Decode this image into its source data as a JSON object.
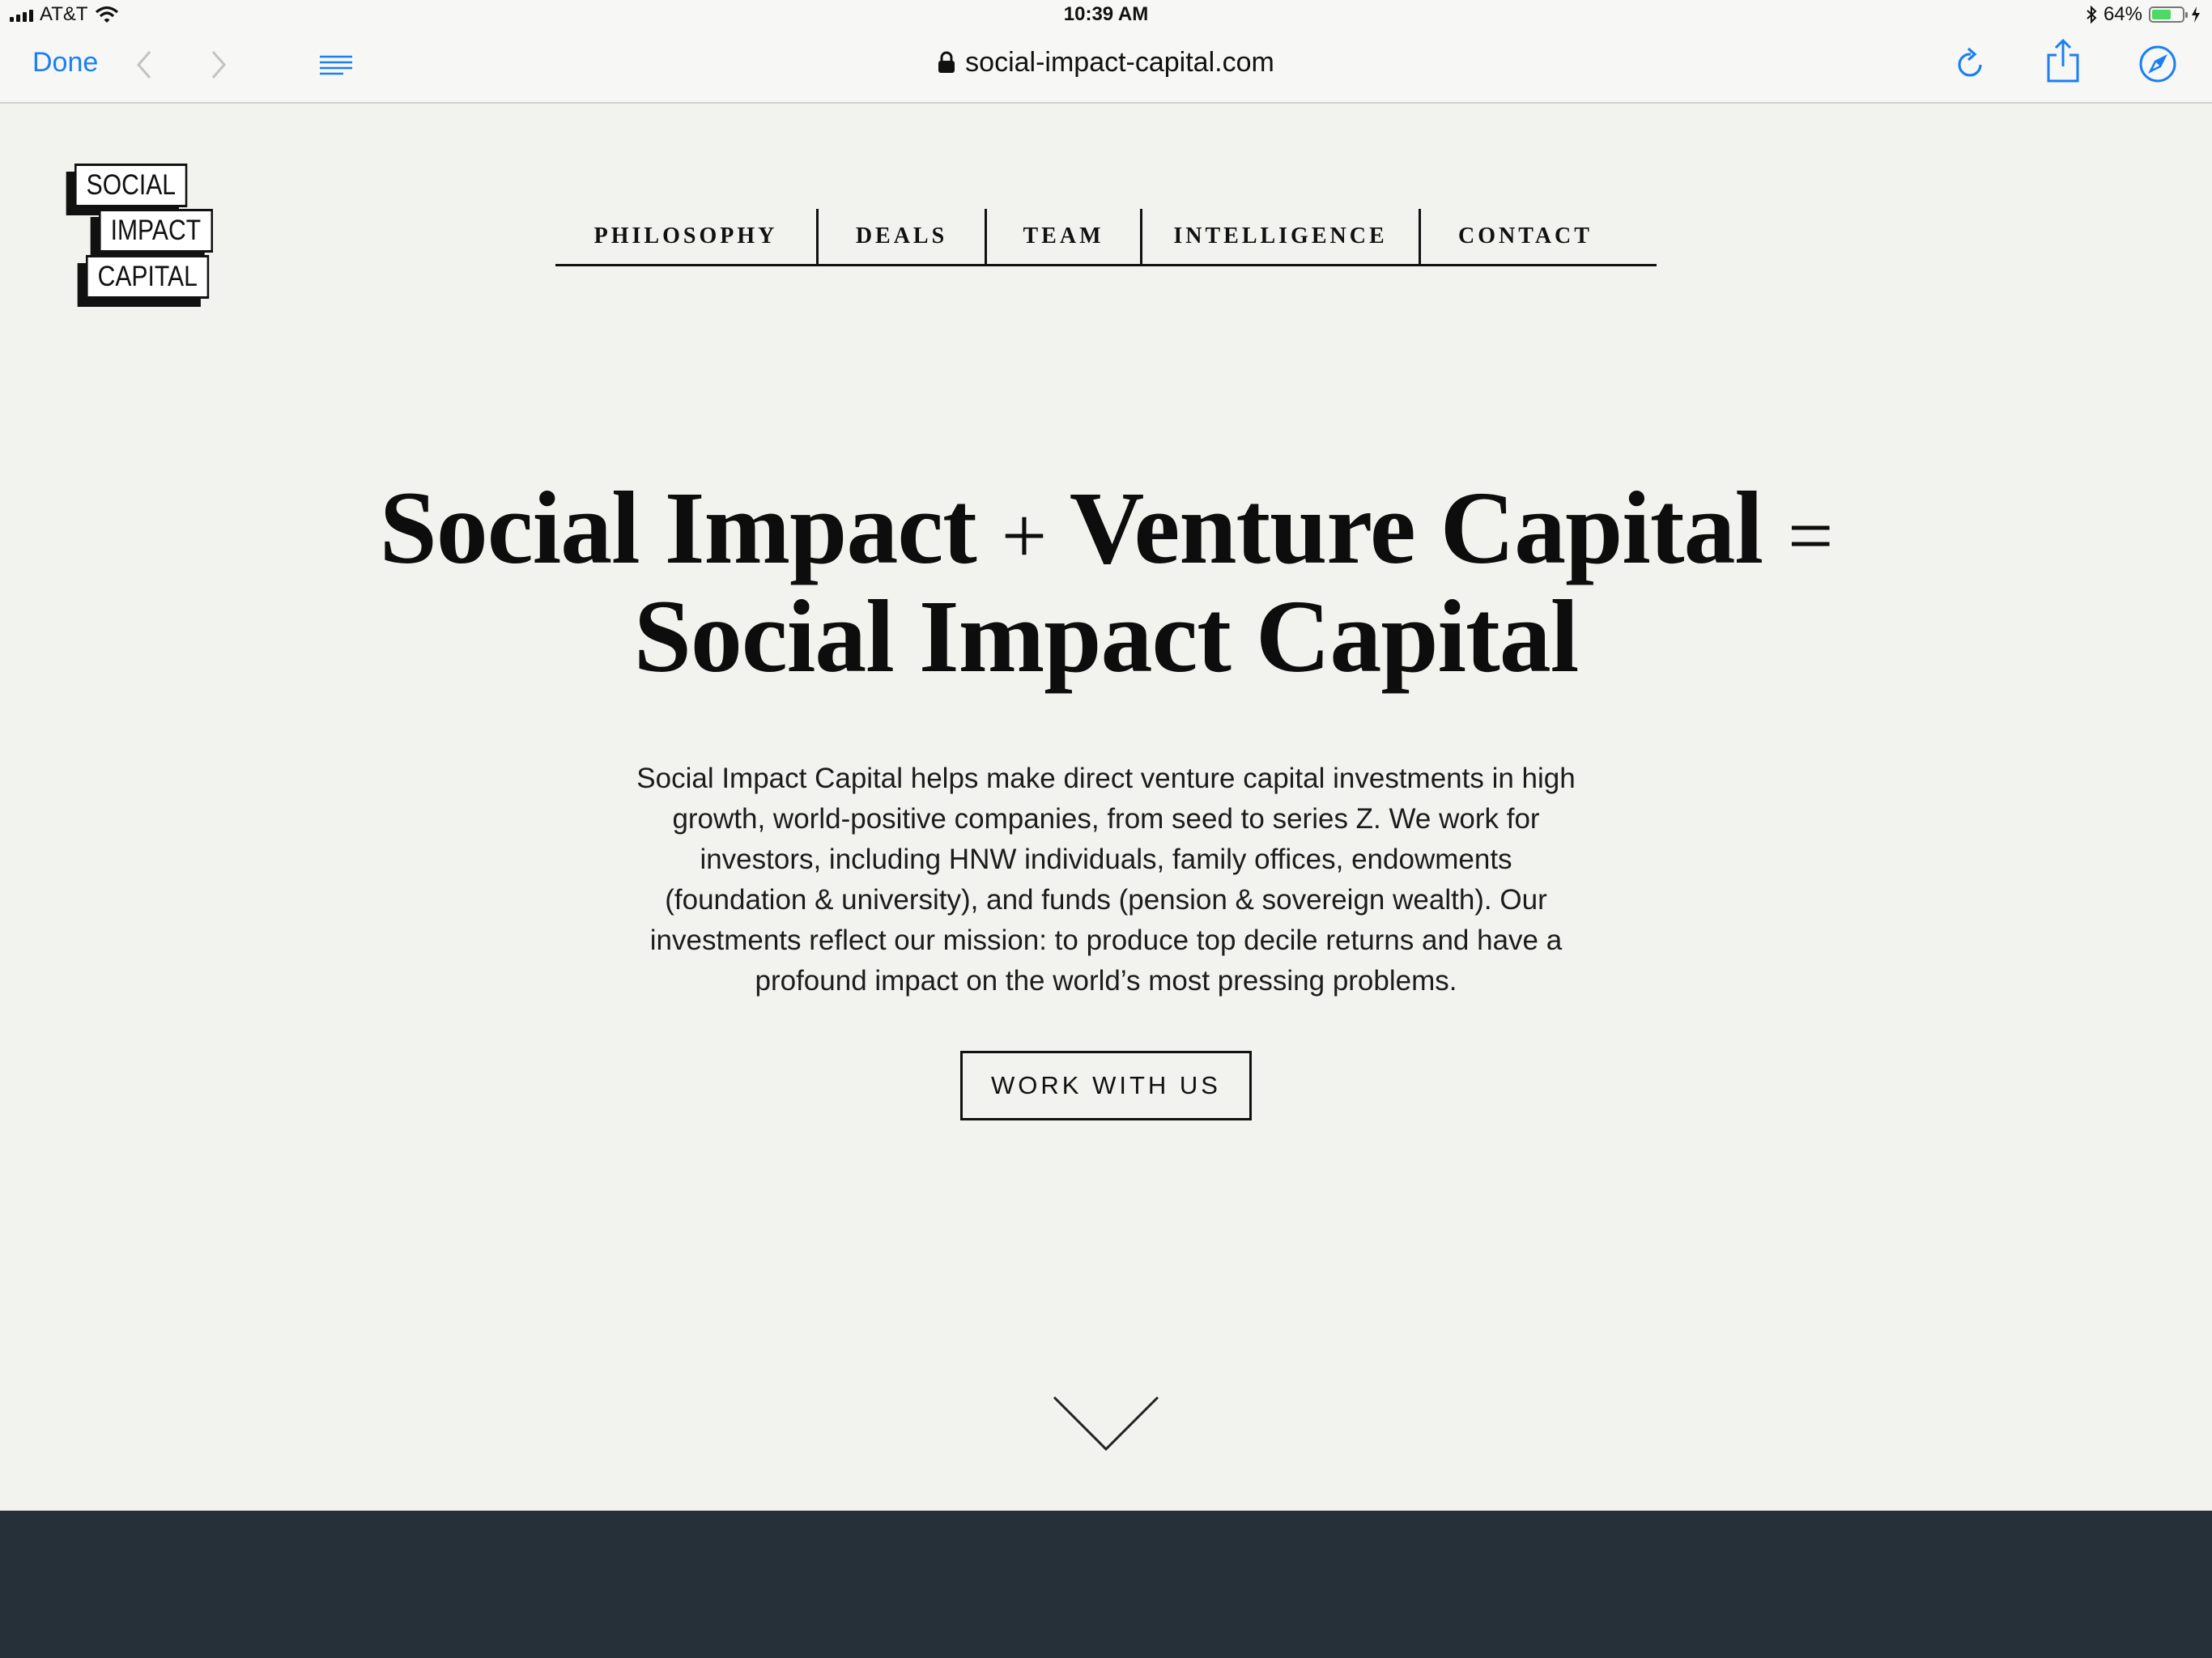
{
  "status_bar": {
    "carrier": "AT&T",
    "time": "10:39 AM",
    "battery": "64%",
    "battery_level": 0.64
  },
  "toolbar": {
    "done_label": "Done",
    "url": "social-impact-capital.com",
    "icons": [
      "back-icon",
      "forward-icon",
      "reader-icon",
      "lock-icon",
      "reload-icon",
      "share-icon",
      "compass-icon"
    ]
  },
  "logo": {
    "line1": "SOCIAL",
    "line2": "IMPACT",
    "line3": "CAPITAL"
  },
  "nav": {
    "items": [
      {
        "label": "PHILOSOPHY"
      },
      {
        "label": "DEALS"
      },
      {
        "label": "TEAM"
      },
      {
        "label": "INTELLIGENCE"
      },
      {
        "label": "CONTACT"
      }
    ]
  },
  "hero": {
    "title_part1": "Social Impact",
    "plus": "+",
    "title_part2": "Venture Capital",
    "equals": "=",
    "title_line2": "Social Impact Capital",
    "body": "Social Impact Capital helps make direct venture capital investments in high growth, world-positive companies, from seed to series Z. We work for investors, including HNW individuals, family offices, endowments (foundation & university), and funds (pension & sovereign wealth). Our investments reflect our mission: to produce top decile returns and have a profound impact on the world’s most pressing problems.",
    "cta_label": "WORK WITH US"
  },
  "colors": {
    "page_bg": "#f2f2ee",
    "ios_blue": "#1a7ff5",
    "dark_band": "#253039",
    "text": "#111111"
  }
}
